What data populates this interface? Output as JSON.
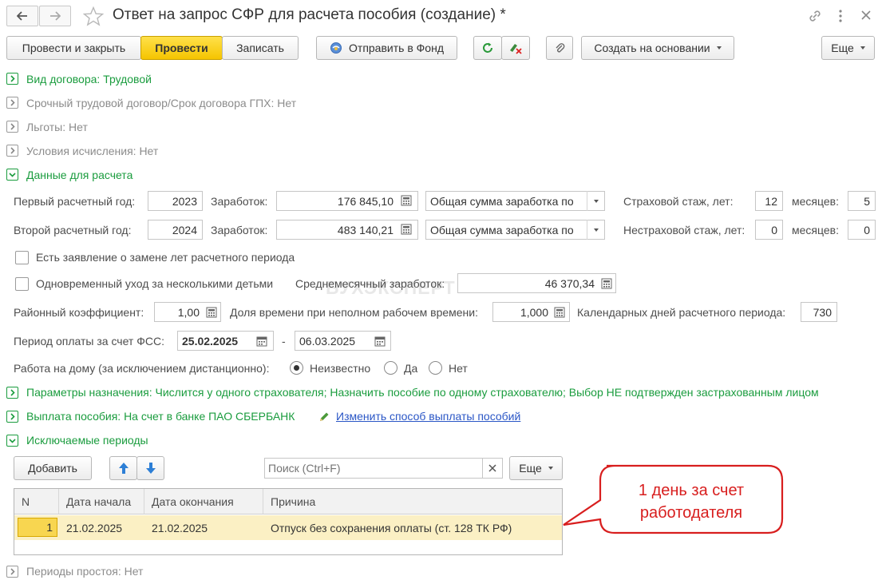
{
  "window": {
    "title": "Ответ на запрос СФР для расчета пособия (создание) *"
  },
  "toolbar": {
    "post_close": "Провести и закрыть",
    "post": "Провести",
    "save": "Записать",
    "send_fund": "Отправить в Фонд",
    "create_based": "Создать на основании",
    "more": "Еще"
  },
  "sections": {
    "contract_type": "Вид договора: Трудовой",
    "fixed_term": "Срочный трудовой договор/Срок договора ГПХ: Нет",
    "benefits": "Льготы: Нет",
    "calc_conditions": "Условия исчисления: Нет",
    "calc_data": "Данные для расчета",
    "assignment_params": "Параметры назначения: Числится у одного страхователя; Назначить пособие по одному страхователю; Выбор НЕ подтвержден застрахованным лицом",
    "payment": "Выплата пособия: На счет в банке ПАО СБЕРБАНК",
    "change_payment_link": "Изменить способ выплаты пособий",
    "excluded_periods": "Исключаемые периоды",
    "idle_periods": "Периоды простоя: Нет"
  },
  "calc": {
    "first_year_label": "Первый расчетный год:",
    "first_year": "2023",
    "second_year_label": "Второй расчетный год:",
    "second_year": "2024",
    "earnings_label": "Заработок:",
    "earnings1": "176 845,10",
    "earnings2": "483 140,21",
    "earnings_type1": "Общая сумма заработка по",
    "earnings_type2": "Общая сумма заработка по",
    "insurance_years_label": "Страховой стаж, лет:",
    "insurance_years": "12",
    "months_label": "месяцев:",
    "insurance_months": "5",
    "non_insurance_years_label": "Нестраховой стаж, лет:",
    "non_insurance_years": "0",
    "non_insurance_months": "0",
    "replace_years_label": "Есть заявление о замене лет расчетного периода",
    "multiple_children_label": "Одновременный уход за несколькими детьми",
    "avg_monthly_label": "Среднемесячный заработок:",
    "avg_monthly": "46 370,34",
    "regional_coef_label": "Районный коэффициент:",
    "regional_coef": "1,00",
    "part_time_label": "Доля времени при неполном рабочем времени:",
    "part_time": "1,000",
    "calendar_days_label": "Календарных дней расчетного периода:",
    "calendar_days": "730",
    "fss_period_label": "Период оплаты за счет ФСС:",
    "fss_from": "25.02.2025",
    "dash": "-",
    "fss_to": "06.03.2025",
    "home_work_label": "Работа на дому (за исключением дистанционно):",
    "radio_unknown": "Неизвестно",
    "radio_yes": "Да",
    "radio_no": "Нет"
  },
  "excluded": {
    "add": "Добавить",
    "search_placeholder": "Поиск (Ctrl+F)",
    "more": "Еще",
    "columns": [
      "N",
      "Дата начала",
      "Дата окончания",
      "Причина"
    ],
    "rows": [
      {
        "n": "1",
        "start": "21.02.2025",
        "end": "21.02.2025",
        "reason": "Отпуск без сохранения оплаты (ст. 128 ТК РФ)"
      }
    ]
  },
  "callout": {
    "line1": "1 день за счет",
    "line2": "работодателя"
  },
  "watermark": "БУХЭКСПЕРТ",
  "colors": {
    "accent_green": "#1a9c3e",
    "primary_yellow": "#f5c400",
    "callout_red": "#d81e1e",
    "row_highlight": "#fbf0c4"
  }
}
